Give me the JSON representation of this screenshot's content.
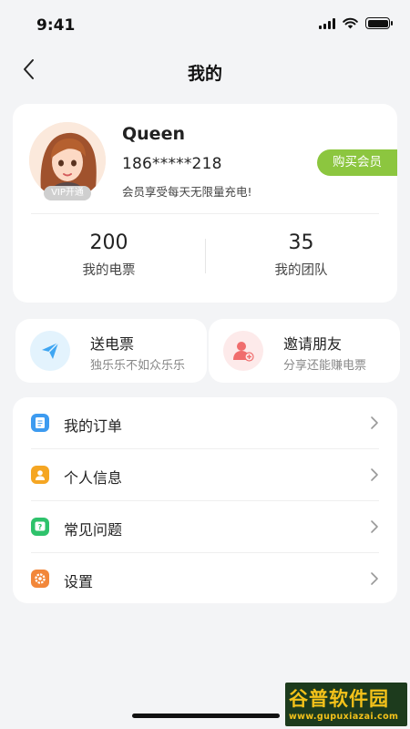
{
  "status_bar": {
    "time": "9:41"
  },
  "nav": {
    "title": "我的"
  },
  "profile": {
    "name": "Queen",
    "phone": "186*****218",
    "description": "会员享受每天无限量充电!",
    "vip_tag": "VIP开通",
    "buy_button": "购买会员",
    "stats": [
      {
        "value": "200",
        "label": "我的电票"
      },
      {
        "value": "35",
        "label": "我的团队"
      }
    ]
  },
  "actions": [
    {
      "title": "送电票",
      "subtitle": "独乐乐不如众乐乐",
      "icon": "paper-plane-icon"
    },
    {
      "title": "邀请朋友",
      "subtitle": "分享还能赚电票",
      "icon": "add-user-icon"
    }
  ],
  "menu": [
    {
      "label": "我的订单",
      "icon": "order-icon",
      "color": "#3d9bf0"
    },
    {
      "label": "个人信息",
      "icon": "profile-icon",
      "color": "#f5a623"
    },
    {
      "label": "常见问题",
      "icon": "faq-icon",
      "color": "#2ec26b"
    },
    {
      "label": "设置",
      "icon": "settings-icon",
      "color": "#f2873a"
    }
  ],
  "colors": {
    "accent_green": "#8cc63f",
    "background": "#f3f4f6"
  },
  "watermark": {
    "brand": "谷普软件园",
    "url": "www.gupuxiazai.com"
  }
}
